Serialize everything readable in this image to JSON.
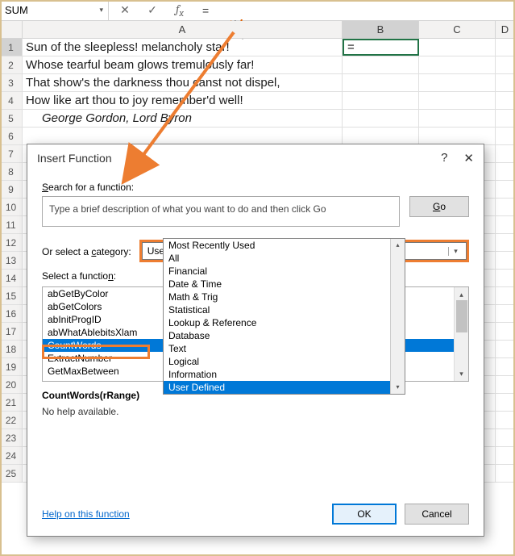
{
  "namebox": "SUM",
  "formula_input": "=",
  "columns": [
    "A",
    "B",
    "C",
    "D"
  ],
  "rows": [
    {
      "n": "1",
      "a": "Sun of the sleepless! melancholy star!",
      "b": "="
    },
    {
      "n": "2",
      "a": "Whose tearful beam glows tremulously far!"
    },
    {
      "n": "3",
      "a": "That show's the darkness thou canst not dispel,"
    },
    {
      "n": "4",
      "a": "How like art thou to joy remember'd well!"
    },
    {
      "n": "5",
      "a": "George Gordon, Lord Byron",
      "italic": true
    },
    {
      "n": "6"
    },
    {
      "n": "7"
    },
    {
      "n": "8"
    },
    {
      "n": "9"
    },
    {
      "n": "10"
    },
    {
      "n": "11"
    },
    {
      "n": "12"
    },
    {
      "n": "13"
    },
    {
      "n": "14"
    },
    {
      "n": "15"
    },
    {
      "n": "16"
    },
    {
      "n": "17"
    },
    {
      "n": "18"
    },
    {
      "n": "19"
    },
    {
      "n": "20"
    },
    {
      "n": "21"
    },
    {
      "n": "22"
    },
    {
      "n": "23"
    },
    {
      "n": "24"
    },
    {
      "n": "25"
    }
  ],
  "dialog": {
    "title": "Insert Function",
    "search_label": "Search for a function:",
    "search_placeholder": "Type a brief description of what you want to do and then click Go",
    "go": "Go",
    "category_label": "Or select a category:",
    "category_value": "User Defined",
    "categories": [
      "Most Recently Used",
      "All",
      "Financial",
      "Date & Time",
      "Math & Trig",
      "Statistical",
      "Lookup & Reference",
      "Database",
      "Text",
      "Logical",
      "Information",
      "User Defined"
    ],
    "select_fn_label": "Select a function:",
    "functions": [
      "abGetByColor",
      "abGetColors",
      "abInitProgID",
      "abWhatAblebitsXlam",
      "CountWords",
      "ExtractNumber",
      "GetMaxBetween"
    ],
    "selected_fn": "CountWords",
    "signature": "CountWords(rRange)",
    "no_help": "No help available.",
    "help_link": "Help on this function",
    "ok": "OK",
    "cancel": "Cancel"
  }
}
